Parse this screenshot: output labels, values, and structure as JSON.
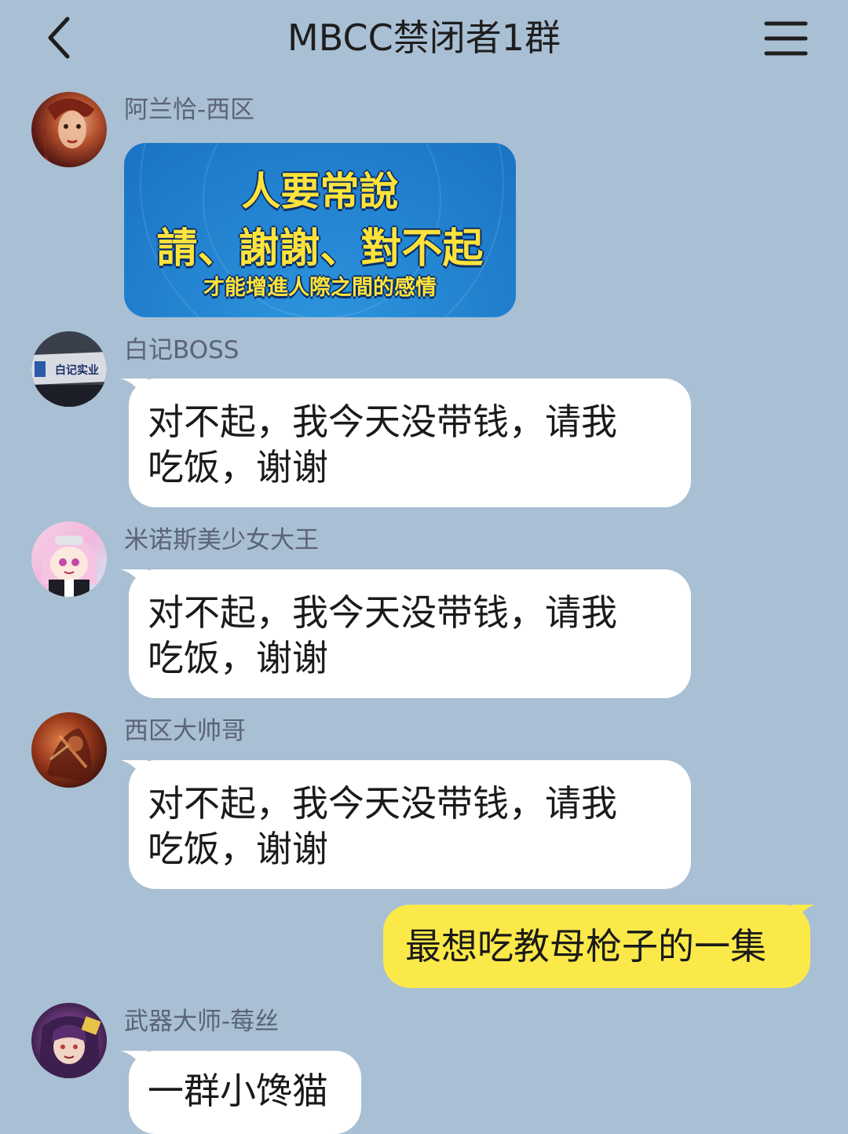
{
  "header": {
    "title": "MBCC禁闭者1群",
    "back_icon": "chevron-left-icon",
    "menu_icon": "hamburger-menu-icon"
  },
  "messages": [
    {
      "sender": "阿兰恰-西区",
      "type": "image",
      "image_text": {
        "line1": "人要常說",
        "line2": "請、謝謝、對不起",
        "line3": "才能增進人際之間的感情"
      },
      "image_colors": {
        "background": "#2587d3",
        "text": "#ffe33b"
      }
    },
    {
      "sender": "白记BOSS",
      "type": "text",
      "text_line1": "对不起，我今天没带钱，请我",
      "text_line2": "吃饭，谢谢",
      "avatar_text": "白记实业"
    },
    {
      "sender": "米诺斯美少女大王",
      "type": "text",
      "text_line1": "对不起，我今天没带钱，请我",
      "text_line2": "吃饭，谢谢"
    },
    {
      "sender": "西区大帅哥",
      "type": "text",
      "text_line1": "对不起，我今天没带钱，请我",
      "text_line2": "吃饭，谢谢"
    },
    {
      "sender": "self",
      "type": "text",
      "text": "最想吃教母枪子的一集"
    },
    {
      "sender": "武器大师-莓丝",
      "type": "text",
      "text": "一群小馋猫"
    }
  ],
  "colors": {
    "background": "#a9bfd4",
    "incoming_bubble": "#ffffff",
    "outgoing_bubble": "#fbe94a"
  }
}
